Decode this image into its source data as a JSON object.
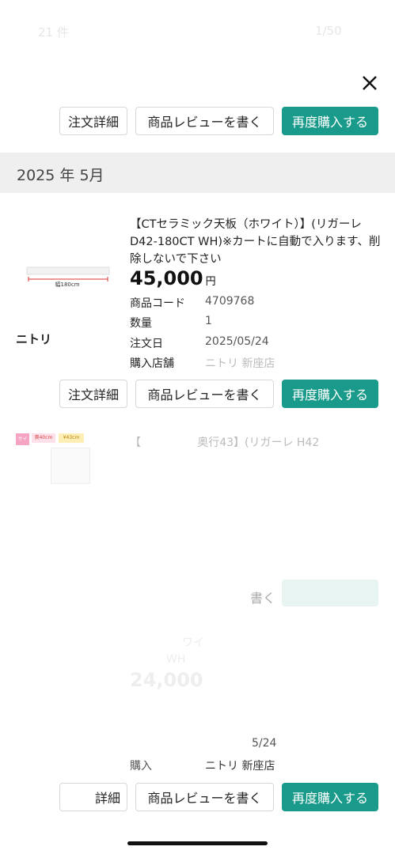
{
  "header_faded": {
    "left": "21 件",
    "right": "1/50"
  },
  "top_buttons": {
    "order_detail": "注文詳細",
    "write_review": "商品レビューを書く",
    "buy_again": "再度購入する"
  },
  "month": {
    "year": "2025",
    "year_unit": "年",
    "month": "5月"
  },
  "item1": {
    "title": "【CTセラミック天板（ホワイト）】(リガーレD42-180CT WH)※カートに自動で入ります、削除しないで下さい",
    "thumb_caption": "幅180cm",
    "brand": "ニトリ",
    "price": "45,000",
    "price_unit": "円",
    "rows": [
      {
        "label": "商品コード",
        "value": "4709768"
      },
      {
        "label": "数量",
        "value": "1"
      },
      {
        "label": "注文日",
        "value": "2025/05/24"
      },
      {
        "label": "購入店舗",
        "value": "ニトリ 新座店"
      }
    ],
    "buttons": {
      "order_detail": "注文詳細",
      "write_review": "商品レビューを書く",
      "buy_again": "再度購入する"
    }
  },
  "item2": {
    "badge": "サイズ",
    "tag1": "奥40cm",
    "tag2": "¥43cm",
    "title_partial": "【                奥行43】(リガーレ H42",
    "review_partial": "書く"
  },
  "item3": {
    "title_partial": "ワイ",
    "title_partial2": "WH",
    "price_partial": "24,000",
    "date_partial": "5/24",
    "store_label_partial": "購入",
    "store_value": "ニトリ 新座店",
    "buttons": {
      "order_detail": "詳細",
      "write_review": "商品レビューを書く",
      "buy_again": "再度購入する"
    }
  }
}
